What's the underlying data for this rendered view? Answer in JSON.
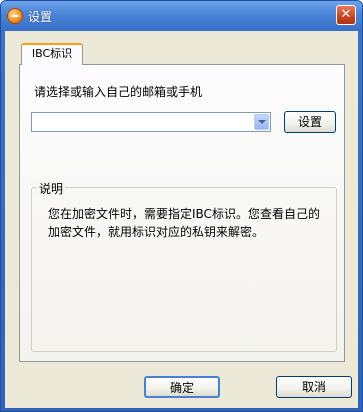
{
  "window": {
    "title": "设置",
    "app_icon": "app-logo-icon",
    "close_glyph": "✕"
  },
  "tabs": [
    {
      "label": "IBC标识",
      "selected": true
    }
  ],
  "form": {
    "prompt": "请选择或输入自己的邮箱或手机",
    "combo_value": "",
    "set_label": "设置"
  },
  "info": {
    "title": "说明",
    "text": "您在加密文件时，需要指定IBC标识。您查看自己的加密文件，就用标识对应的私钥来解密。"
  },
  "footer": {
    "ok_label": "确定",
    "cancel_label": "取消"
  },
  "colors": {
    "titlebar": "#3c72c9",
    "client": "#ece9d8",
    "tab_accent": "#f6a11a",
    "close_button": "#c8431f"
  }
}
